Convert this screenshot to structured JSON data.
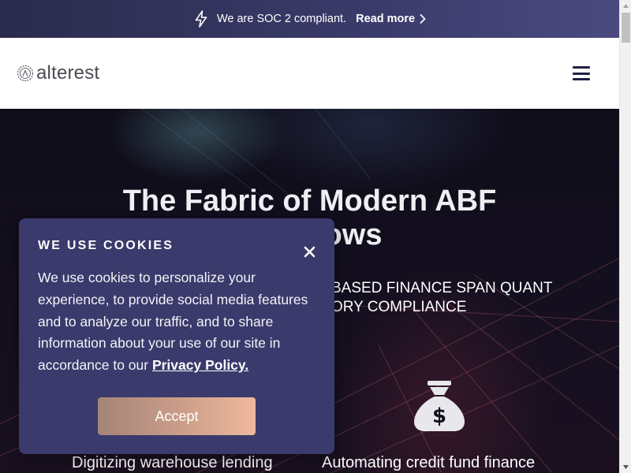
{
  "announcement": {
    "text": "We are SOC 2 compliant.",
    "link_label": "Read more",
    "icon": "lightning-bolt-icon"
  },
  "header": {
    "logo_text": "alterest",
    "logo_icon": "alterest-logo-mark-icon",
    "menu_icon": "hamburger-menu-icon"
  },
  "hero": {
    "title_line1": "The Fabric of Modern ABF",
    "title_line2_visible": "ows",
    "subtitle_line1_visible": "BASED FINANCE SPAN QUANT",
    "subtitle_line2_visible": "ORY COMPLIANCE",
    "feature_icon": "money-bag-icon",
    "features": [
      {
        "label": "Digitizing warehouse lending"
      },
      {
        "label": "Automating credit fund finance"
      }
    ]
  },
  "cookie_banner": {
    "title": "WE USE COOKIES",
    "body": "We use cookies to personalize your experience, to provide social media features and to analyze our traffic, and to share information about your use of our site in accordance to our ",
    "privacy_link": "Privacy Policy.",
    "accept_label": "Accept",
    "close_icon": "close-icon"
  },
  "colors": {
    "announce_bg": "#2a2c4d",
    "header_bg": "#ffffff",
    "hero_bg": "#120f1c",
    "cookie_bg": "#3a3a6c",
    "accept_gradient_start": "#a48478",
    "accept_gradient_end": "#efb99d",
    "menu_icon": "#1f2044"
  }
}
